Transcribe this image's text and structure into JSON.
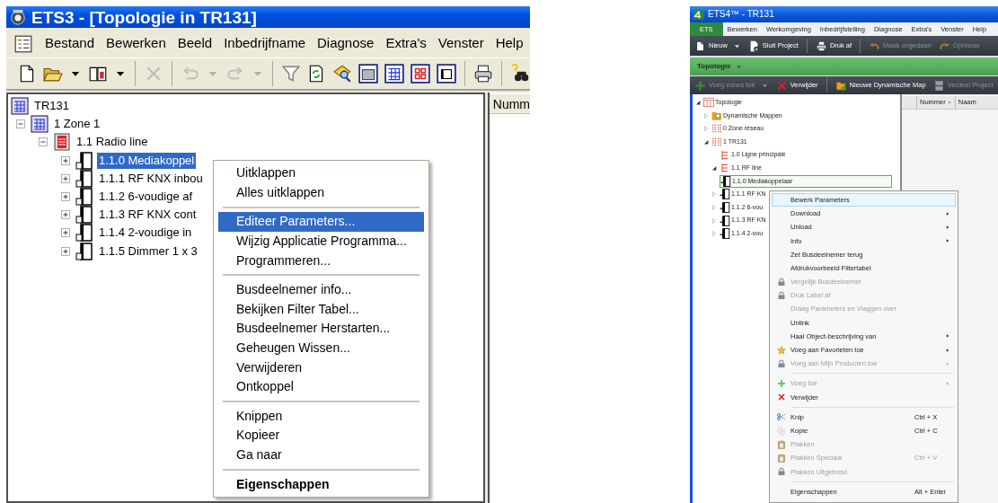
{
  "ets3": {
    "window": {
      "title": "ETS3 - [Topologie in TR131]"
    },
    "menu_bar": [
      "Bestand",
      "Bewerken",
      "Beeld",
      "Inbedrijfname",
      "Diagnose",
      "Extra's",
      "Venster",
      "Help"
    ],
    "toolbar": [
      {
        "kind": "new",
        "disabled": false,
        "dropdown": false
      },
      {
        "kind": "open",
        "disabled": false,
        "dropdown": true
      },
      {
        "kind": "book",
        "disabled": false,
        "dropdown": true
      },
      {
        "kind": "separator"
      },
      {
        "kind": "delete",
        "disabled": true,
        "dropdown": false
      },
      {
        "kind": "separator"
      },
      {
        "kind": "undo",
        "disabled": true,
        "dropdown": true
      },
      {
        "kind": "redo",
        "disabled": true,
        "dropdown": true
      },
      {
        "kind": "separator"
      },
      {
        "kind": "filter",
        "disabled": false,
        "dropdown": false
      },
      {
        "kind": "refresh",
        "disabled": false,
        "dropdown": false
      },
      {
        "kind": "inspect",
        "disabled": false,
        "dropdown": false
      },
      {
        "kind": "panel",
        "disabled": false,
        "dropdown": false
      },
      {
        "kind": "table",
        "disabled": false,
        "dropdown": false
      },
      {
        "kind": "redgrid",
        "disabled": false,
        "dropdown": false
      },
      {
        "kind": "window",
        "disabled": false,
        "dropdown": false
      },
      {
        "kind": "separator"
      },
      {
        "kind": "print",
        "disabled": false,
        "dropdown": false
      },
      {
        "kind": "separator"
      },
      {
        "kind": "find",
        "disabled": false,
        "dropdown": false
      }
    ],
    "tree": [
      {
        "label": "TR131",
        "kind": "project",
        "selected": false,
        "children": [
          {
            "label": "1 Zone 1",
            "kind": "zone",
            "expanded": true,
            "selected": false,
            "children": [
              {
                "label": "1.1 Radio line",
                "kind": "line",
                "expanded": true,
                "selected": false,
                "children": [
                  {
                    "label": "1.1.0 Mediakoppel",
                    "kind": "device",
                    "expanded": false,
                    "selected": true
                  },
                  {
                    "label": "1.1.1 RF KNX inbou",
                    "kind": "device",
                    "expanded": false,
                    "selected": false
                  },
                  {
                    "label": "1.1.2 6-voudige af",
                    "kind": "device",
                    "expanded": false,
                    "selected": false
                  },
                  {
                    "label": "1.1.3 RF KNX cont",
                    "kind": "device",
                    "expanded": false,
                    "selected": false
                  },
                  {
                    "label": "1.1.4 2-voudige in",
                    "kind": "device",
                    "expanded": false,
                    "selected": false
                  },
                  {
                    "label": "1.1.5 Dimmer 1 x 3",
                    "kind": "device",
                    "expanded": false,
                    "selected": false
                  }
                ]
              }
            ]
          }
        ]
      }
    ],
    "list_header": "Numm",
    "context_menu": [
      [
        {
          "label": "Uitklappen",
          "selected": false,
          "default": false
        },
        {
          "label": "Alles uitklappen",
          "selected": false,
          "default": false
        }
      ],
      [
        {
          "label": "Editeer Parameters...",
          "selected": true,
          "default": false
        },
        {
          "label": "Wijzig Applicatie Programma...",
          "selected": false,
          "default": false
        },
        {
          "label": "Programmeren...",
          "selected": false,
          "default": false
        }
      ],
      [
        {
          "label": "Busdeelnemer info...",
          "selected": false,
          "default": false
        },
        {
          "label": "Bekijken Filter Tabel...",
          "selected": false,
          "default": false
        },
        {
          "label": "Busdeelnemer Herstarten...",
          "selected": false,
          "default": false
        },
        {
          "label": "Geheugen Wissen...",
          "selected": false,
          "default": false
        },
        {
          "label": "Verwijderen",
          "selected": false,
          "default": false
        },
        {
          "label": "Ontkoppel",
          "selected": false,
          "default": false
        }
      ],
      [
        {
          "label": "Knippen",
          "selected": false,
          "default": false
        },
        {
          "label": "Kopieer",
          "selected": false,
          "default": false
        },
        {
          "label": "Ga naar",
          "selected": false,
          "default": false
        }
      ],
      [
        {
          "label": "Eigenschappen",
          "selected": false,
          "default": true
        }
      ]
    ]
  },
  "ets4": {
    "window": {
      "title": "ETS4™ - TR131"
    },
    "menu_bar": [
      {
        "label": "ETS",
        "selected": true
      },
      {
        "label": "Bewerken",
        "selected": false
      },
      {
        "label": "Werkomgeving",
        "selected": false
      },
      {
        "label": "Inbedrijfstelling",
        "selected": false
      },
      {
        "label": "Diagnose",
        "selected": false
      },
      {
        "label": "Extra's",
        "selected": false
      },
      {
        "label": "Venster",
        "selected": false
      },
      {
        "label": "Help",
        "selected": false
      }
    ],
    "toolbar": [
      [
        {
          "label": "Nieuw",
          "kind": "new",
          "dropdown": true,
          "disabled": false
        },
        {
          "label": "Sluit Project",
          "kind": "close",
          "dropdown": false,
          "disabled": false
        }
      ],
      [
        {
          "label": "Druk af",
          "kind": "print",
          "dropdown": false,
          "disabled": false
        }
      ],
      [
        {
          "label": "Maak ongedaan",
          "kind": "undo",
          "dropdown": false,
          "disabled": true
        },
        {
          "label": "Opnieuw",
          "kind": "redo",
          "dropdown": false,
          "disabled": true
        }
      ]
    ],
    "view_bar": {
      "label": "Topologie"
    },
    "sub_toolbar": [
      [
        {
          "label": "Voeg zones toe",
          "kind": "plus",
          "dropdown": true,
          "disabled": true
        },
        {
          "label": "Verwijder",
          "kind": "cross",
          "dropdown": false,
          "disabled": false
        }
      ],
      [
        {
          "label": "Nieuwe Dynamische Map",
          "kind": "folderplus",
          "dropdown": false,
          "disabled": false
        },
        {
          "label": "Verdeel Project",
          "kind": "doc",
          "dropdown": false,
          "disabled": true
        }
      ]
    ],
    "tree": [
      {
        "label": "Topologie",
        "kind": "topology",
        "expanded": true,
        "selected": false,
        "children": [
          {
            "label": "Dynamische Mappen",
            "kind": "dynamic",
            "expanded": false,
            "selected": false
          },
          {
            "label": "0 Zone réseau",
            "kind": "zone",
            "expanded": false,
            "selected": false
          },
          {
            "label": "1 TR131",
            "kind": "zone",
            "expanded": true,
            "selected": false,
            "children": [
              {
                "label": "1.0 Ligne principale",
                "kind": "line",
                "selected": false
              },
              {
                "label": "1.1 RF line",
                "kind": "line",
                "expanded": true,
                "selected": false,
                "children": [
                  {
                    "label": "1.1.0 Mediakoppelaar",
                    "kind": "device",
                    "selected": true
                  },
                  {
                    "label": "1.1.1 RF KN",
                    "kind": "device",
                    "expanded": false,
                    "selected": false
                  },
                  {
                    "label": "1.1.2 6-vou",
                    "kind": "device",
                    "expanded": false,
                    "selected": false
                  },
                  {
                    "label": "1.1.3 RF KN",
                    "kind": "device",
                    "expanded": false,
                    "selected": false
                  },
                  {
                    "label": "1.1.4 2-vou",
                    "kind": "device",
                    "expanded": false,
                    "selected": false
                  }
                ]
              }
            ]
          }
        ]
      }
    ],
    "table_columns": [
      {
        "label": "Nummer",
        "sorted": true
      },
      {
        "label": "Naam",
        "sorted": false
      }
    ],
    "context_menu": [
      [
        {
          "label": "Bewerk Parameters",
          "selected": true,
          "disabled": false,
          "submenu": false
        },
        {
          "label": "Download",
          "selected": false,
          "disabled": false,
          "submenu": true
        },
        {
          "label": "Unload",
          "selected": false,
          "disabled": false,
          "submenu": true
        },
        {
          "label": "Info",
          "selected": false,
          "disabled": false,
          "submenu": true
        },
        {
          "label": "Zet Busdeelnemer terug",
          "selected": false,
          "disabled": false,
          "submenu": false
        },
        {
          "label": "Afdrukvoorbeeld Filtertabel",
          "selected": false,
          "disabled": false,
          "submenu": false
        },
        {
          "label": "Vergelijk Busdeelnemer",
          "kind": "lock",
          "selected": false,
          "disabled": true,
          "submenu": false
        },
        {
          "label": "Druk Label af",
          "kind": "lock",
          "selected": false,
          "disabled": true,
          "submenu": false
        },
        {
          "label": "Draag Parameters en Vlaggen over",
          "selected": false,
          "disabled": true,
          "submenu": false
        },
        {
          "label": "Unlink",
          "selected": false,
          "disabled": false,
          "submenu": false
        },
        {
          "label": "Haal Object-beschrijving van",
          "selected": false,
          "disabled": false,
          "submenu": true
        },
        {
          "label": "Voeg aan Favorieten toe",
          "kind": "star",
          "selected": false,
          "disabled": false,
          "submenu": true
        },
        {
          "label": "Voeg aan Mijn Producten toe",
          "kind": "lock",
          "selected": false,
          "disabled": true,
          "submenu": true
        }
      ],
      [
        {
          "label": "Voeg toe",
          "kind": "plus",
          "selected": false,
          "disabled": true,
          "submenu": true
        },
        {
          "label": "Verwijder",
          "kind": "cross",
          "selected": false,
          "disabled": false,
          "submenu": false
        }
      ],
      [
        {
          "label": "Knip",
          "kind": "scissors",
          "shortcut": "Ctrl + X",
          "selected": false,
          "disabled": false,
          "submenu": false
        },
        {
          "label": "Kopie",
          "kind": "copy",
          "shortcut": "Ctrl + C",
          "selected": false,
          "disabled": false,
          "submenu": false
        },
        {
          "label": "Plakken",
          "kind": "paste",
          "selected": false,
          "disabled": true,
          "submenu": false
        },
        {
          "label": "Plakken Speciaal",
          "kind": "paste",
          "shortcut": "Ctrl + V",
          "selected": false,
          "disabled": true,
          "submenu": false
        },
        {
          "label": "Plakken Uitgebreid",
          "kind": "lock",
          "selected": false,
          "disabled": true,
          "submenu": false
        }
      ],
      [
        {
          "label": "Eigenschappen",
          "shortcut": "Alt + Enter",
          "selected": false,
          "disabled": false,
          "submenu": false
        }
      ]
    ]
  }
}
